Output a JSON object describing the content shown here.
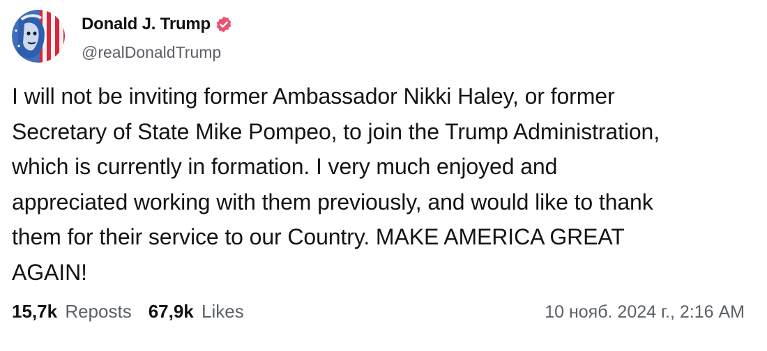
{
  "author": {
    "display_name": "Donald J. Trump",
    "handle": "@realDonaldTrump",
    "verified": true,
    "verified_icon": "verified-badge-icon",
    "avatar_icon": "profile-avatar"
  },
  "post": {
    "text": "I will not be inviting former Ambassador Nikki Haley, or former\nSecretary of State Mike Pompeo, to join the Trump Administration,\nwhich is currently in formation. I very much enjoyed and\nappreciated working with them previously, and would like to thank\nthem for their service to our Country. MAKE AMERICA GREAT\nAGAIN!"
  },
  "stats": {
    "reposts_count": "15,7k",
    "reposts_label": "Reposts",
    "likes_count": "67,9k",
    "likes_label": "Likes"
  },
  "timestamp": "10 нояб. 2024 г., 2:16 AM",
  "colors": {
    "verified_badge": "#e8546c",
    "secondary_text": "#5b5f66",
    "primary_text": "#121212"
  }
}
